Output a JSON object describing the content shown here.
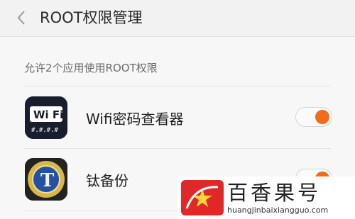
{
  "header": {
    "title": "ROOT权限管理"
  },
  "section": {
    "header": "允许2个应用使用ROOT权限"
  },
  "apps": [
    {
      "label": "Wifi密码查看器",
      "icon_text": "Wi Fi",
      "icon_subtext": "#.#.#.#",
      "enabled": true
    },
    {
      "label": "钛备份",
      "icon_text": "T",
      "enabled": true
    }
  ],
  "colors": {
    "toggle_on": "#f26b1d",
    "background": "#f7f7f7",
    "titlebar": "#f2f2f2"
  },
  "watermark": {
    "text": "百香果号",
    "url": "huangjinbaixiangguo.com"
  }
}
